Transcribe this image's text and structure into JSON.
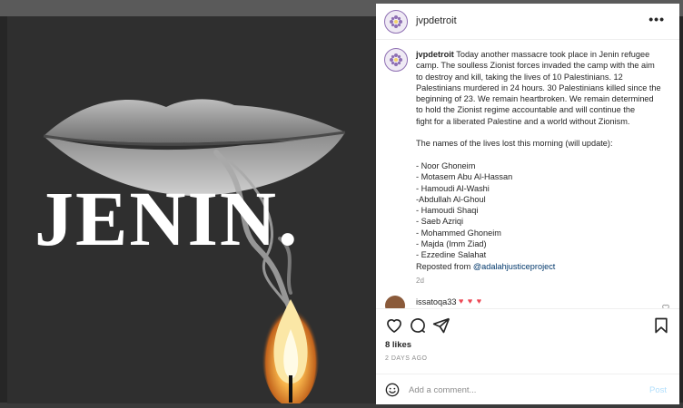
{
  "post": {
    "username": "jvpdetroit",
    "image_title": "JENIN.",
    "caption": {
      "lines": [
        "Today another massacre took place in Jenin refugee",
        "camp. The soulless Zionist forces invaded the camp with the aim",
        "to destroy and kill, taking the lives of 10 Palestinians. 12",
        "Palestinians murdered in 24 hours. 30 Palestinians killed since the",
        "beginning of 23. We remain heartbroken. We remain determined",
        "to hold the Zionist regime accountable and will continue the",
        "fight for a liberated Palestine and a world without Zionism."
      ],
      "names_intro": "The names of the lives lost this morning (will update):",
      "names": [
        "- Noor Ghoneim",
        "- Motasem Abu Al-Hassan",
        "- Hamoudi Al-Washi",
        "-Abdullah Al-Ghoul",
        "- Hamoudi Shaqi",
        "- Saeb Azriqi",
        "- Mohammed Ghoneim",
        "- Majda (Imm Ziad)",
        "- Ezzedine Salahat"
      ],
      "repost_prefix": "Reposted from",
      "repost_handle": "@adalahjusticeproject",
      "time": "2d"
    },
    "comment": {
      "username": "issatoqa33",
      "text": "♥ ♥ ♥"
    },
    "likes": "8 likes",
    "date": "2 DAYS AGO",
    "comment_placeholder": "Add a comment...",
    "post_label": "Post",
    "more_label": "•••"
  },
  "colors": {
    "accent": "#0095f6",
    "post_disabled": "#b2dffc",
    "heart": "#ed4956",
    "avatar_ring": "#8e6fb3"
  },
  "icons": [
    "more-icon",
    "heart-icon",
    "comment-icon",
    "share-icon",
    "save-icon",
    "emoji-icon"
  ]
}
